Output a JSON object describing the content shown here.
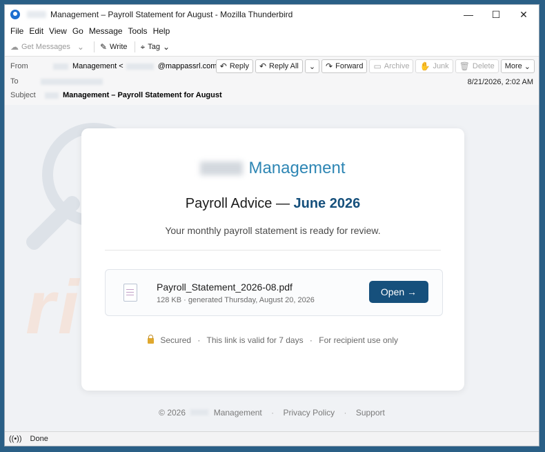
{
  "window": {
    "title": "Management – Payroll Statement for August - Mozilla Thunderbird",
    "minimize": "—",
    "maximize": "☐",
    "close": "✕"
  },
  "menu": [
    "File",
    "Edit",
    "View",
    "Go",
    "Message",
    "Tools",
    "Help"
  ],
  "toolbar": {
    "get_messages": "Get Messages",
    "write": "Write",
    "tag": "Tag"
  },
  "header": {
    "from_label": "From",
    "from_name": "Management <",
    "from_email": "@mappassrl.com>",
    "to_label": "To",
    "subject_label": "Subject",
    "subject": "Management – Payroll Statement for August",
    "date": "8/21/2026, 2:02 AM",
    "actions": {
      "reply": "Reply",
      "reply_all": "Reply All",
      "forward": "Forward",
      "archive": "Archive",
      "junk": "Junk",
      "delete": "Delete",
      "more": "More"
    }
  },
  "email": {
    "brand": "Management",
    "title_prefix": "Payroll Advice —",
    "title_highlight": "June 2026",
    "subtitle": "Your monthly payroll statement is ready for review.",
    "file_name": "Payroll_Statement_2026-08.pdf",
    "file_meta": "128 KB · generated Thursday, August 20, 2026",
    "open_button": "Open →",
    "secure": "Secured",
    "valid": "This link is valid for 7 days",
    "recipient": "For recipient use only",
    "footer_copyright": "© 2026",
    "footer_company": "Management",
    "footer_privacy": "Privacy Policy",
    "footer_support": "Support"
  },
  "status": {
    "text": "Done"
  },
  "watermark": "risk.com",
  "colors": {
    "accent": "#16507c",
    "brand": "#2e86b4"
  }
}
